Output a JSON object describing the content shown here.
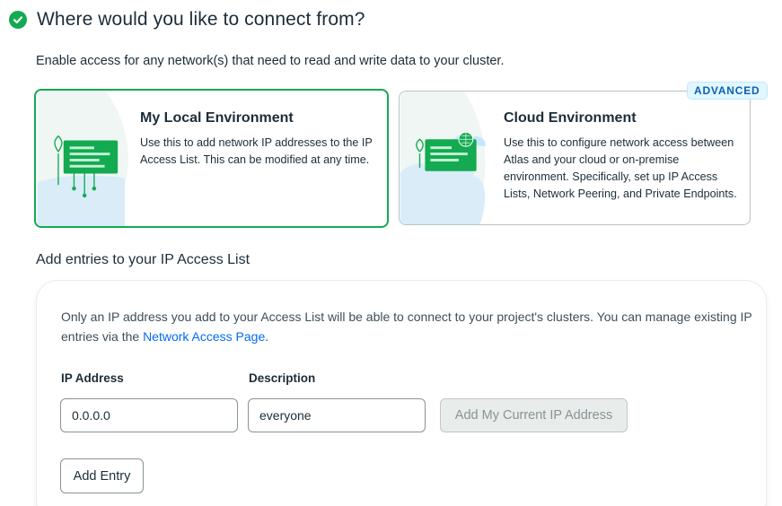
{
  "header": {
    "title": "Where would you like to connect from?",
    "status_icon": "check-circle-icon",
    "status_color": "#13aa52"
  },
  "intro_text": "Enable access for any network(s) that need to read and write data to your cluster.",
  "options": {
    "local": {
      "title": "My Local Environment",
      "description": "Use this to add network IP addresses to the IP Access List. This can be modified at any time.",
      "selected": true
    },
    "cloud": {
      "title": "Cloud Environment",
      "description": "Use this to configure network access between Atlas and your cloud or on-premise environment. Specifically, set up IP Access Lists, Network Peering, and Private Endpoints.",
      "badge": "ADVANCED",
      "selected": false
    }
  },
  "access_list": {
    "section_title": "Add entries to your IP Access List",
    "description_prefix": "Only an IP address you add to your Access List will be able to connect to your project's clusters. You can manage existing IP entries via the ",
    "description_link": "Network Access Page",
    "description_suffix": ".",
    "ip_label": "IP Address",
    "ip_value": "0.0.0.0",
    "desc_label": "Description",
    "desc_value": "everyone",
    "add_current_ip_label": "Add My Current IP Address",
    "add_entry_label": "Add Entry"
  },
  "colors": {
    "accent_green": "#13aa52",
    "link_blue": "#016bf8",
    "badge_blue": "#0c61b3"
  }
}
